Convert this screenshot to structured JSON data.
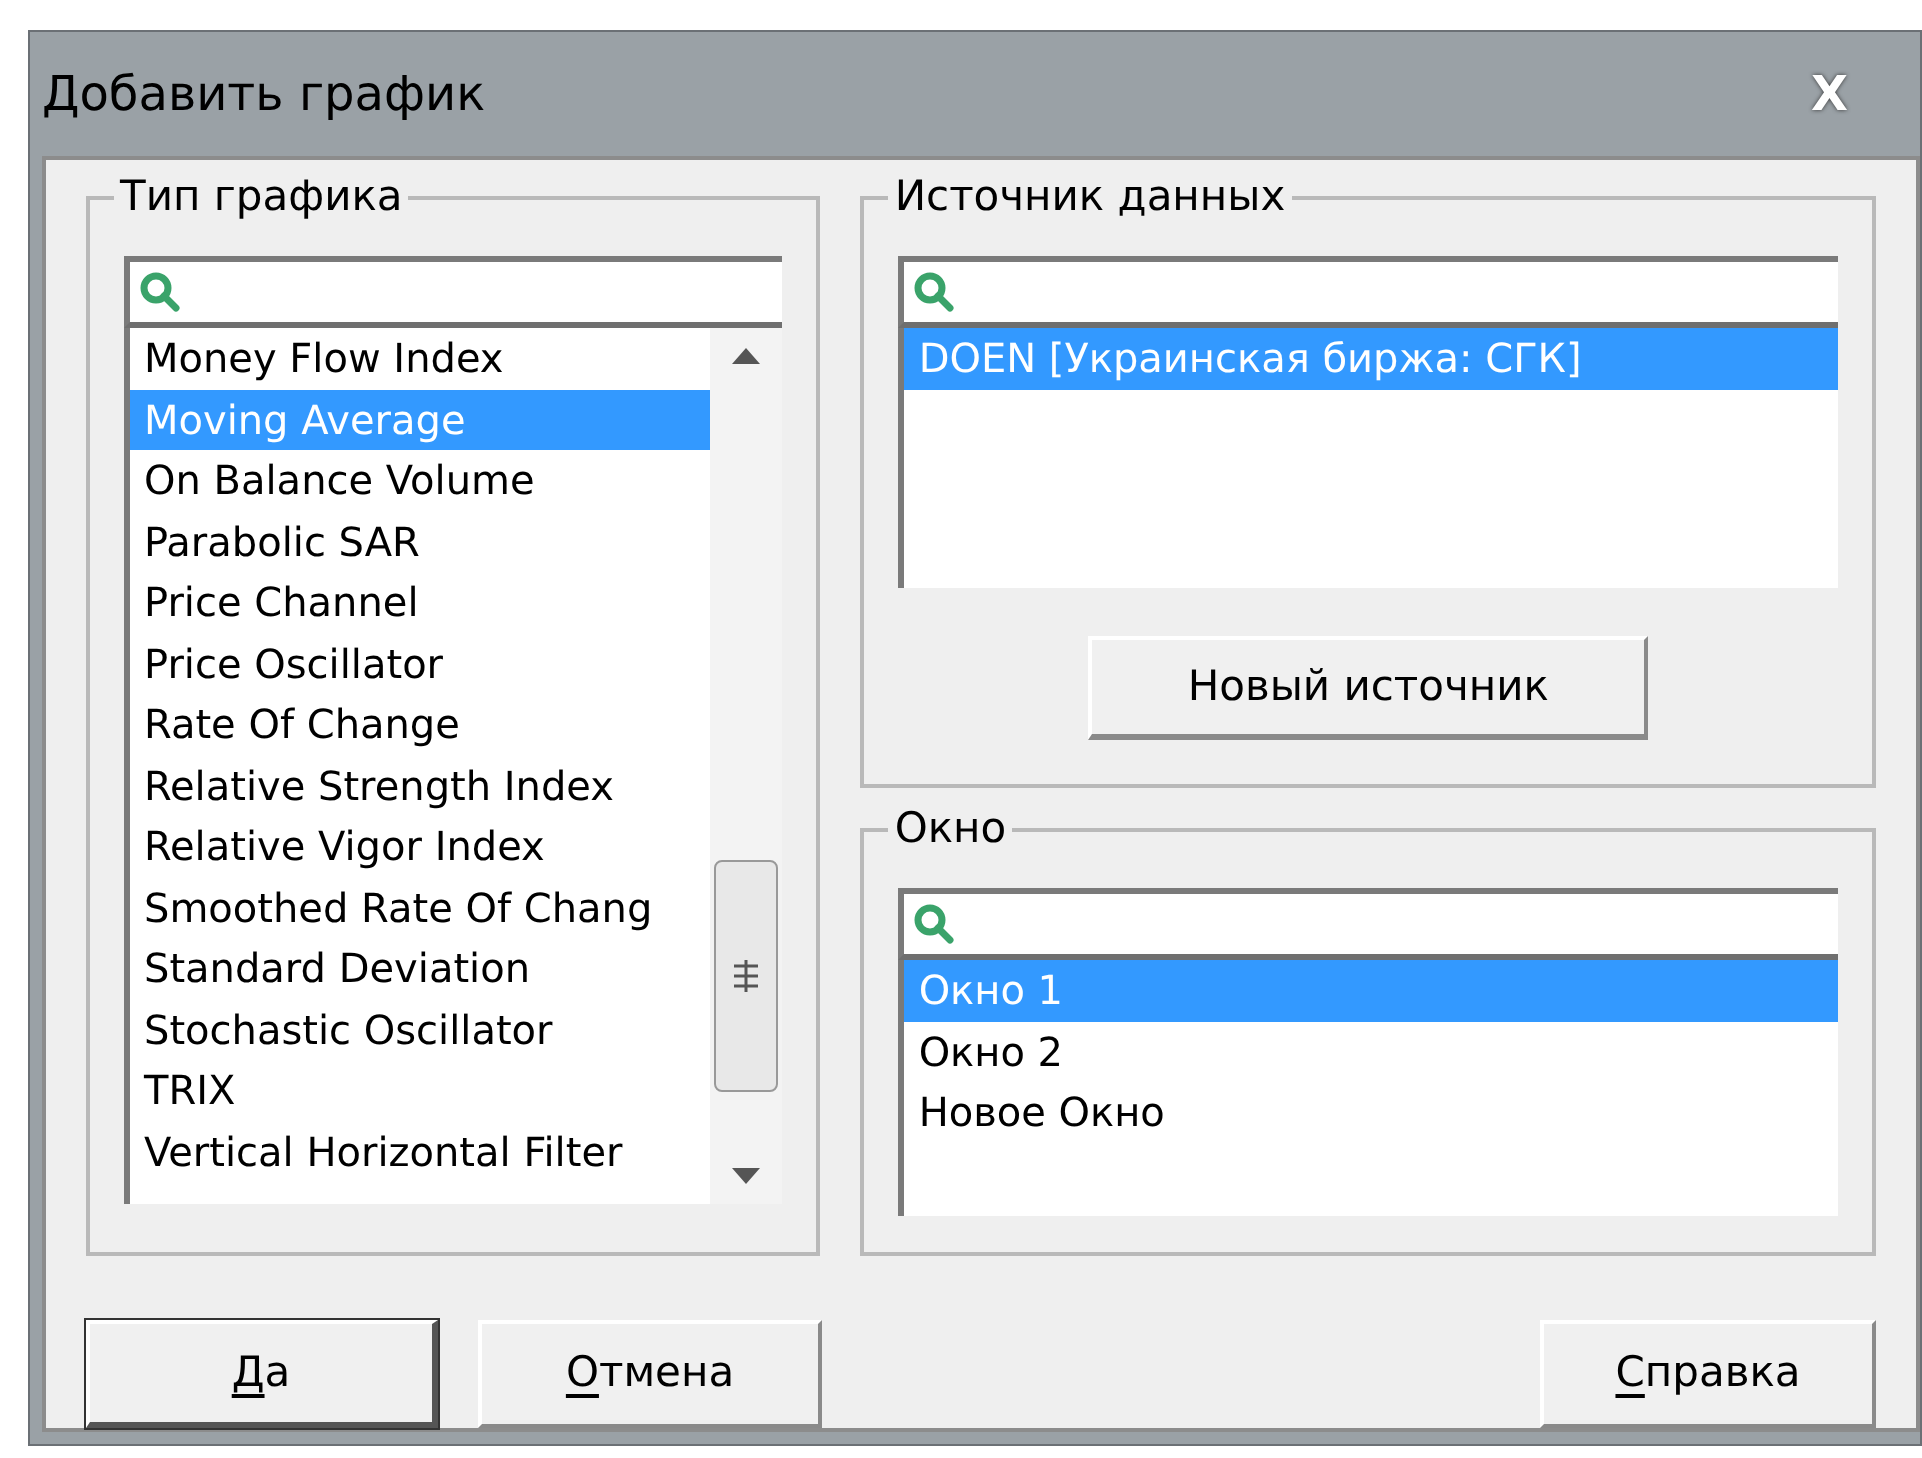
{
  "window": {
    "title": "Добавить график",
    "close": "X"
  },
  "chart_type": {
    "title": "Тип графика",
    "items": [
      {
        "label": "Money Flow Index",
        "selected": false
      },
      {
        "label": "Moving Average",
        "selected": true
      },
      {
        "label": "On Balance Volume",
        "selected": false
      },
      {
        "label": "Parabolic SAR",
        "selected": false
      },
      {
        "label": "Price Channel",
        "selected": false
      },
      {
        "label": "Price Oscillator",
        "selected": false
      },
      {
        "label": "Rate Of Change",
        "selected": false
      },
      {
        "label": "Relative Strength Index",
        "selected": false
      },
      {
        "label": "Relative Vigor Index",
        "selected": false
      },
      {
        "label": "Smoothed Rate Of Chang",
        "selected": false
      },
      {
        "label": "Standard Deviation",
        "selected": false
      },
      {
        "label": "Stochastic Oscillator",
        "selected": false
      },
      {
        "label": "TRIX",
        "selected": false
      },
      {
        "label": "Vertical Horizontal Filter",
        "selected": false
      }
    ]
  },
  "data_source": {
    "title": "Источник данных",
    "items": [
      {
        "label": "DOEN [Украинская биржа: СГК]",
        "selected": true
      }
    ],
    "new_button": "Новый источник"
  },
  "window_group": {
    "title": "Окно",
    "items": [
      {
        "label": "Окно 1",
        "selected": true
      },
      {
        "label": "Окно 2",
        "selected": false
      },
      {
        "label": "Новое Окно",
        "selected": false
      }
    ]
  },
  "buttons": [
    {
      "label": "Да",
      "default": true
    },
    {
      "label": "Отмена",
      "default": false
    },
    {
      "label": "Справка",
      "default": false
    }
  ]
}
